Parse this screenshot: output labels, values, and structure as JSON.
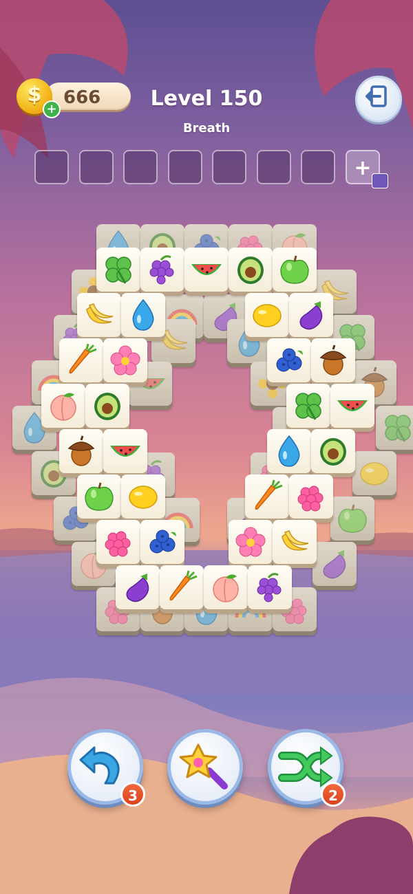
{
  "hud": {
    "coins": "666",
    "level_title": "Level 150",
    "level_subtitle": "Breath",
    "slot_count": 7
  },
  "board_top": [
    "clover",
    "grapes",
    "watermelon",
    "avocado",
    "apple",
    "banana",
    "water-drop",
    "lemon",
    "eggplant",
    "carrot",
    "flower",
    "blueberry",
    "acorn",
    "peach",
    "avocado",
    "clover",
    "watermelon",
    "acorn",
    "watermelon",
    "water-drop",
    "avocado",
    "apple",
    "lemon",
    "carrot",
    "raspberry",
    "raspberry",
    "blueberry",
    "flower",
    "banana",
    "eggplant",
    "carrot",
    "peach",
    "grapes"
  ],
  "boosters": {
    "undo_count": "3",
    "shuffle_count": "2"
  },
  "colors": {
    "sky_top": "#5d4f92",
    "sunset": "#efa88d",
    "slot_border": "#ffffff",
    "badge": "#e0502a"
  }
}
